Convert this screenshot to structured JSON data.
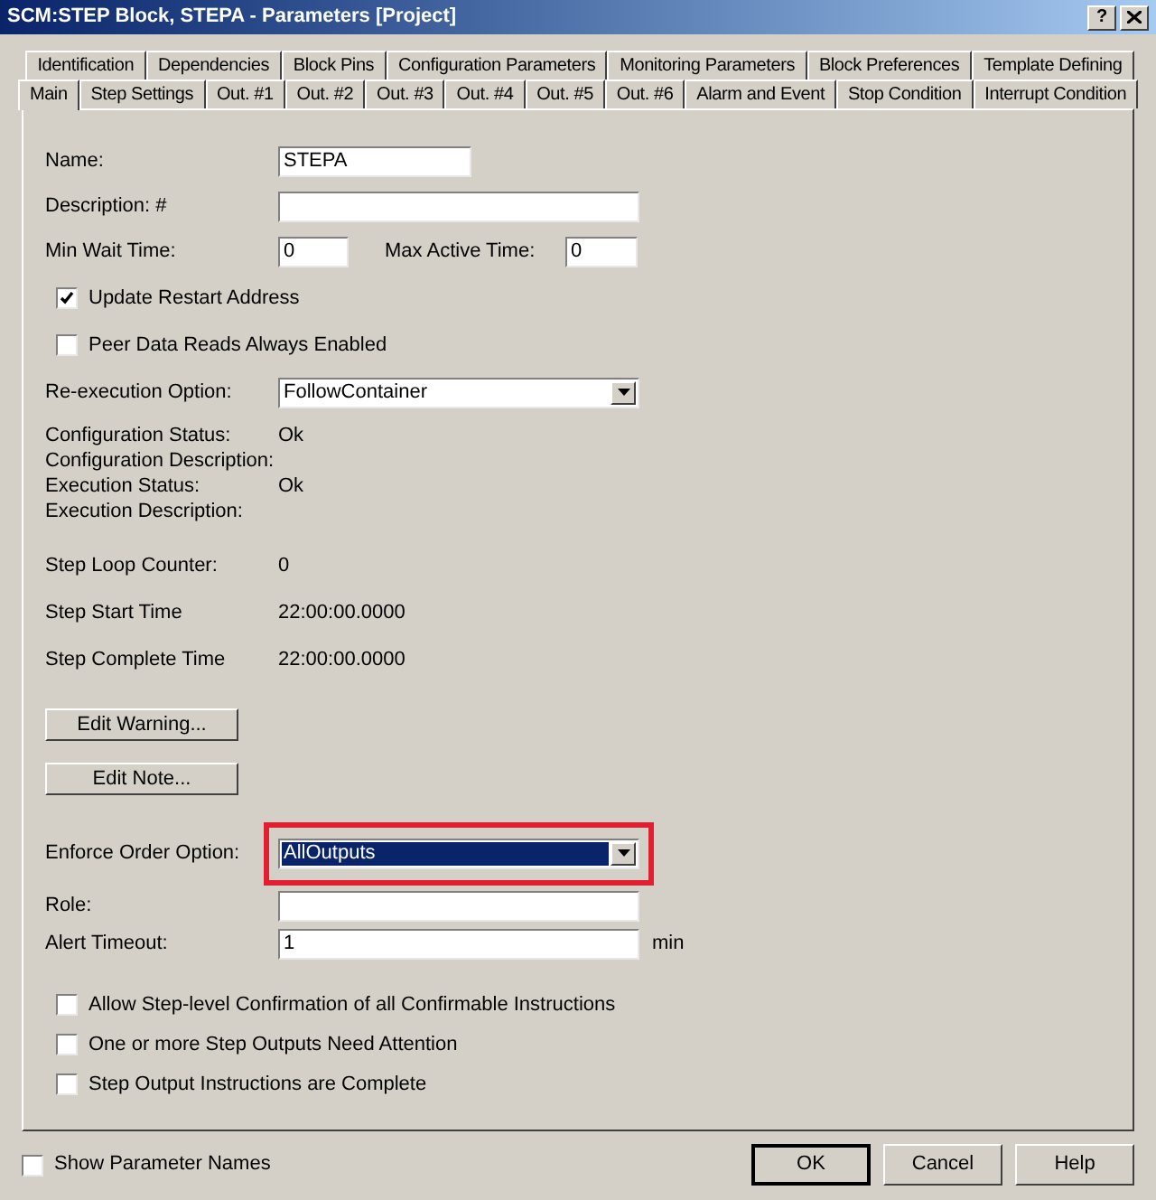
{
  "window": {
    "title": "SCM:STEP Block, STEPA - Parameters [Project]",
    "help": "?"
  },
  "tab_rows": [
    [
      {
        "label": "Identification",
        "selected": false
      },
      {
        "label": "Dependencies",
        "selected": false
      },
      {
        "label": "Block Pins",
        "selected": false
      },
      {
        "label": "Configuration Parameters",
        "selected": false
      },
      {
        "label": "Monitoring Parameters",
        "selected": false
      },
      {
        "label": "Block Preferences",
        "selected": false
      },
      {
        "label": "Template Defining",
        "selected": false
      }
    ],
    [
      {
        "label": "Main",
        "selected": true
      },
      {
        "label": "Step Settings",
        "selected": false
      },
      {
        "label": "Out. #1",
        "selected": false
      },
      {
        "label": "Out. #2",
        "selected": false
      },
      {
        "label": "Out. #3",
        "selected": false
      },
      {
        "label": "Out. #4",
        "selected": false
      },
      {
        "label": "Out. #5",
        "selected": false
      },
      {
        "label": "Out. #6",
        "selected": false
      },
      {
        "label": "Alarm and Event",
        "selected": false
      },
      {
        "label": "Stop Condition",
        "selected": false
      },
      {
        "label": "Interrupt Condition",
        "selected": false
      }
    ]
  ],
  "main": {
    "name": {
      "label": "Name:",
      "value": "STEPA"
    },
    "description": {
      "label": "Description: #"
    },
    "min_wait": {
      "label": "Min Wait Time:",
      "value": "0"
    },
    "max_active": {
      "label": "Max Active Time:",
      "value": "0"
    },
    "restart_options": [
      {
        "label": "Update Restart Address",
        "checked": true
      },
      {
        "label": "Peer Data Reads Always Enabled",
        "checked": false
      }
    ],
    "reexecution": {
      "label": "Re-execution Option:",
      "value": "FollowContainer",
      "highlighted": false,
      "focused": false
    },
    "status": [
      {
        "label": "Configuration Status:",
        "value": "Ok"
      },
      {
        "label": "Configuration Description:"
      },
      {
        "label": "Execution Status:",
        "value": "Ok"
      },
      {
        "label": "Execution Description:"
      }
    ],
    "step_info": [
      {
        "label": "Step Loop Counter:",
        "value": "0"
      },
      {
        "label": "Step Start Time",
        "value": "22:00:00.0000"
      },
      {
        "label": "Step Complete Time",
        "value": "22:00:00.0000"
      }
    ],
    "buttons": [
      "Edit Warning...",
      "Edit Note..."
    ],
    "enforce_order": {
      "label": "Enforce Order Option:",
      "value": "AllOutputs",
      "highlighted": true,
      "focused": true
    },
    "role": {
      "label": "Role:"
    },
    "alert_timeout": {
      "label": "Alert Timeout:",
      "value": "1",
      "unit": "min"
    },
    "confirm_options": [
      {
        "label": "Allow Step-level Confirmation of all Confirmable Instructions",
        "checked": false
      },
      {
        "label": "One or more Step Outputs Need Attention",
        "checked": false
      },
      {
        "label": "Step Output Instructions are Complete",
        "checked": false
      }
    ]
  },
  "footer": {
    "show_names": {
      "label": "Show Parameter Names",
      "checked": false
    },
    "buttons": [
      {
        "label": "OK",
        "default": true
      },
      {
        "label": "Cancel",
        "default": false
      },
      {
        "label": "Help",
        "default": false
      }
    ]
  }
}
